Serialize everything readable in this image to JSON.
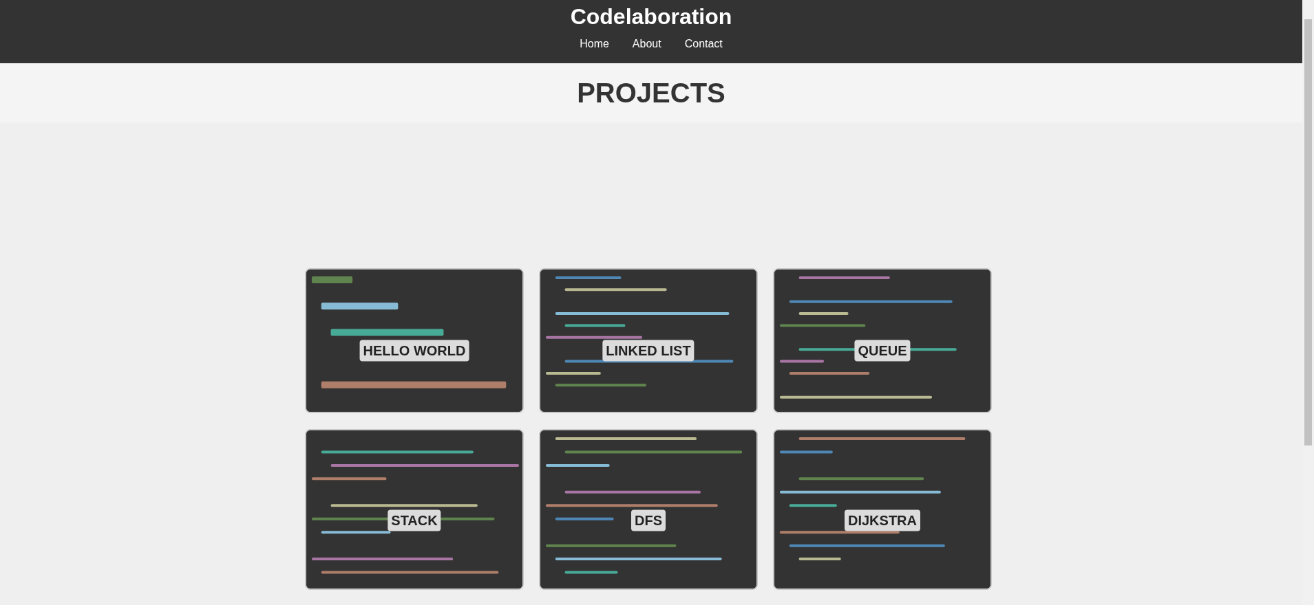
{
  "header": {
    "title": "Codelaboration",
    "nav": [
      {
        "label": "Home"
      },
      {
        "label": "About"
      },
      {
        "label": "Contact"
      }
    ]
  },
  "section": {
    "heading": "PROJECTS"
  },
  "projects": [
    {
      "title": "HELLO WORLD"
    },
    {
      "title": "LINKED LIST"
    },
    {
      "title": "QUEUE"
    },
    {
      "title": "STACK"
    },
    {
      "title": "DFS"
    },
    {
      "title": "DIJKSTRA"
    }
  ]
}
